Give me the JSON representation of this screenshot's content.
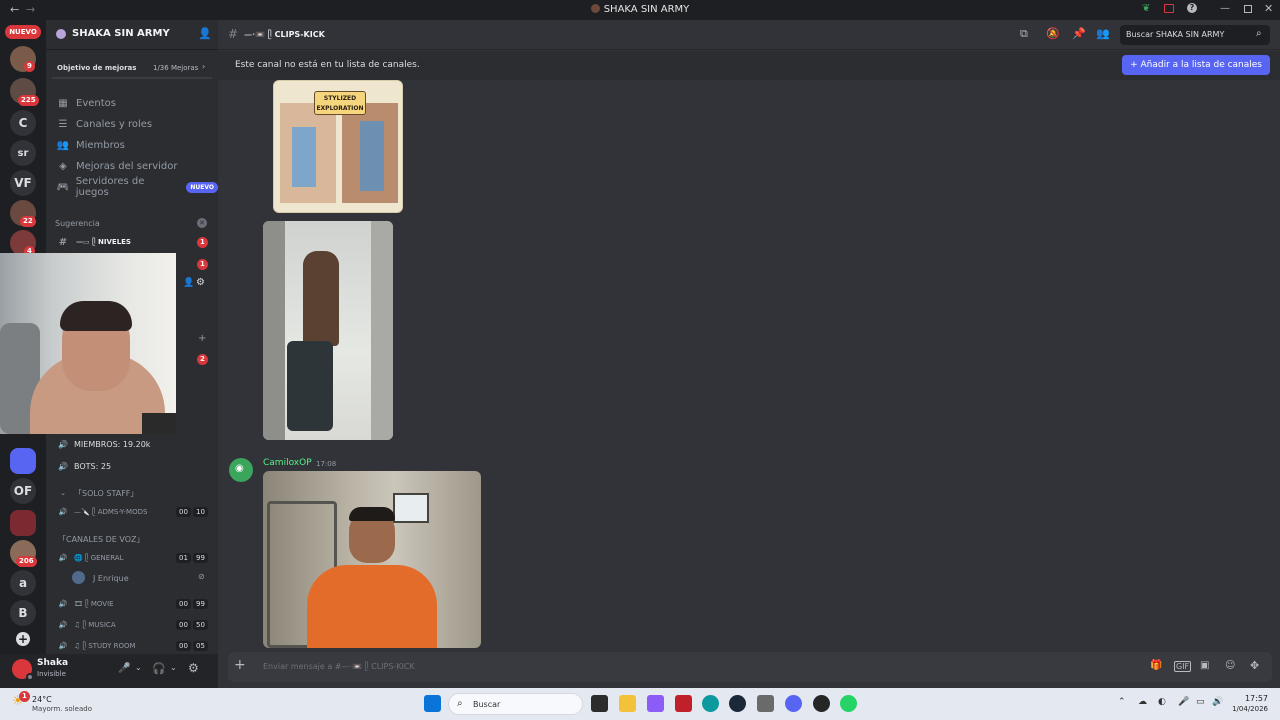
{
  "titlebar": {
    "title": "SHAKA SIN ARMY"
  },
  "guilds": {
    "new_badge": "NUEVO",
    "badges": [
      "9",
      "225",
      "22",
      "4",
      "206"
    ],
    "letters": [
      "C",
      "sr",
      "VF",
      "OF",
      "a",
      "B"
    ]
  },
  "server": {
    "name": "SHAKA SIN ARMY",
    "boost_goal": "Objetivo de mejoras",
    "boost_count": "1/36 Mejoras",
    "menu": [
      "Eventos",
      "Canales y roles",
      "Miembros",
      "Mejoras del servidor",
      "Servidores de juegos"
    ],
    "new_tag": "NUEVO",
    "suggestion_label": "Sugerencia",
    "niveles_channel": "NIVELES",
    "niveles_badge": "1",
    "second_badge": "1",
    "third_badge": "2",
    "members_stat": "MIEMBROS: 19.20k",
    "bots_stat": "BOTS: 25",
    "solo_staff": "「SOLO STAFF」",
    "adms_channel": "ADMS-Y-MODS",
    "adms_counts": [
      "00",
      "10"
    ],
    "voice_category": "「CANALES DE VOZ」",
    "general_channel": "GENERAL",
    "general_counts": [
      "01",
      "99"
    ],
    "voice_user": "J Enrique",
    "movie_channel": "MOVIE",
    "movie_counts": [
      "00",
      "99"
    ],
    "musica_channel": "MUSICA",
    "musica_counts": [
      "00",
      "50"
    ],
    "study_channel": "STUDY ROOM",
    "study_counts": [
      "00",
      "05"
    ]
  },
  "user": {
    "name": "Shaka",
    "status": "Invisible"
  },
  "channel": {
    "name": "CLIPS-KICK",
    "search_placeholder": "Buscar SHAKA SIN ARMY",
    "notice": "Este canal no está en tu lista de canales.",
    "add_button": "+  Añadir a la lista de canales",
    "composer_placeholder": "Enviar mensaje a #—·📼 ᥫ CLIPS-KICK"
  },
  "messages": {
    "comic_title_1": "STYLIZED",
    "comic_title_2": "EXPLORATION",
    "author": "CamiloxOP",
    "time": "17:08"
  },
  "taskbar": {
    "weather_temp": "24°C",
    "weather_desc": "Mayorm. soleado",
    "search": "Buscar",
    "clock_time": "17:57",
    "clock_date": "1/04/2026",
    "notif_badge": "1"
  },
  "colors": {
    "accent": "#5865f2",
    "danger": "#da373c",
    "author": "#57f287",
    "bg": "#313338"
  }
}
